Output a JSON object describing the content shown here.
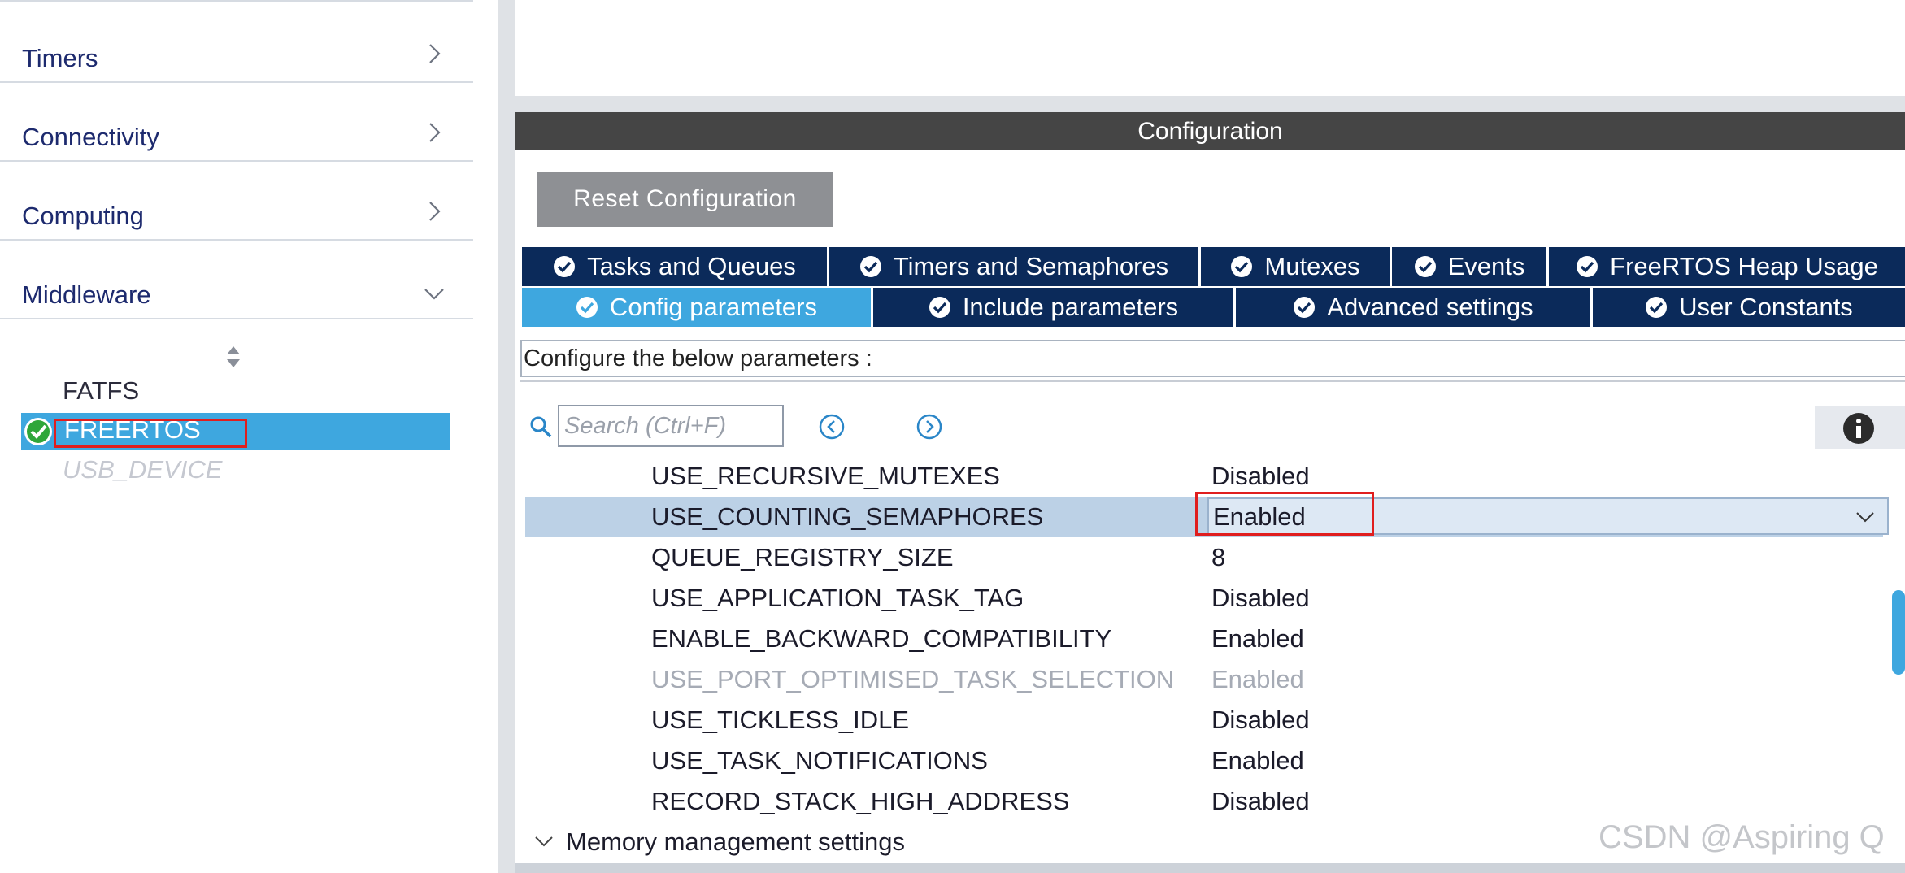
{
  "sidebar": {
    "categories": [
      {
        "label": "Timers"
      },
      {
        "label": "Connectivity"
      },
      {
        "label": "Computing"
      },
      {
        "label": "Middleware"
      }
    ],
    "middleware_items": [
      {
        "label": "FATFS",
        "state": "normal"
      },
      {
        "label": "FREERTOS",
        "state": "selected-enabled"
      },
      {
        "label": "USB_DEVICE",
        "state": "disabled"
      }
    ]
  },
  "config": {
    "header": "Configuration",
    "reset_label": "Reset Configuration",
    "tabs_row1": [
      {
        "label": "Tasks and Queues"
      },
      {
        "label": "Timers and Semaphores"
      },
      {
        "label": "Mutexes"
      },
      {
        "label": "Events"
      },
      {
        "label": "FreeRTOS Heap Usage"
      }
    ],
    "tabs_row2": [
      {
        "label": "Config parameters",
        "active": true
      },
      {
        "label": "Include parameters"
      },
      {
        "label": "Advanced settings"
      },
      {
        "label": "User Constants"
      }
    ],
    "description": "Configure the below parameters :",
    "search_placeholder": "Search (Ctrl+F)",
    "params": [
      {
        "name": "USE_RECURSIVE_MUTEXES",
        "value": "Disabled"
      },
      {
        "name": "USE_COUNTING_SEMAPHORES",
        "value": "Enabled",
        "selected": true
      },
      {
        "name": "QUEUE_REGISTRY_SIZE",
        "value": "8"
      },
      {
        "name": "USE_APPLICATION_TASK_TAG",
        "value": "Disabled"
      },
      {
        "name": "ENABLE_BACKWARD_COMPATIBILITY",
        "value": "Enabled"
      },
      {
        "name": "USE_PORT_OPTIMISED_TASK_SELECTION",
        "value": "Enabled",
        "disabled": true
      },
      {
        "name": "USE_TICKLESS_IDLE",
        "value": "Disabled"
      },
      {
        "name": "USE_TASK_NOTIFICATIONS",
        "value": "Enabled"
      },
      {
        "name": "RECORD_STACK_HIGH_ADDRESS",
        "value": "Disabled"
      }
    ],
    "section_label": "Memory management settings"
  },
  "watermark": "CSDN @Aspiring Q",
  "colors": {
    "accent": "#3ea7df",
    "tab_dark": "#0b2a5a",
    "highlight_red": "#e01e1e",
    "header_dark": "#454545"
  },
  "icons": [
    "chevron-right-icon",
    "chevron-down-icon",
    "check-circle-icon",
    "search-icon",
    "arrow-left-circle-icon",
    "arrow-right-circle-icon",
    "info-icon",
    "sort-icon"
  ]
}
